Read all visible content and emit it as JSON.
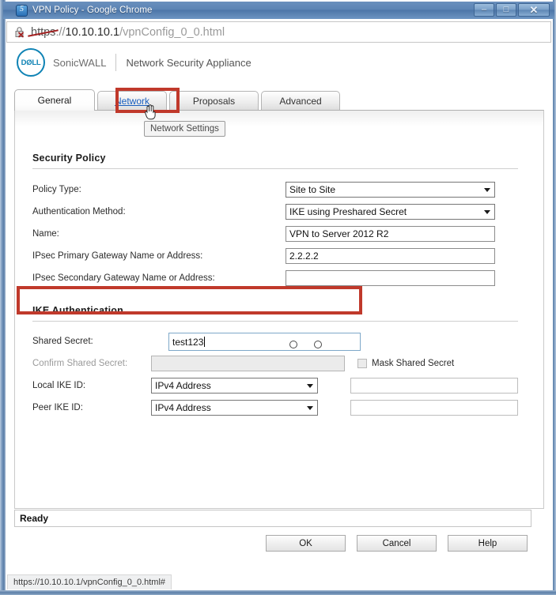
{
  "window": {
    "title": "VPN Policy - Google Chrome",
    "icon": "chrome-icon",
    "minimize_label": "–",
    "maximize_label": "□",
    "close_label": "✕"
  },
  "address_bar": {
    "security_icon": "insecure-lock-icon",
    "scheme": "https",
    "separator": "://",
    "host": "10.10.10.1",
    "path": "/vpnConfig_0_0.html",
    "full_url": "https://10.10.10.1/vpnConfig_0_0.html"
  },
  "brand": {
    "logo_text": "DØLL",
    "logo_name": "dell-logo",
    "vendor": "SonicWALL",
    "product": "Network Security Appliance"
  },
  "tabs": [
    {
      "label": "General",
      "active": true,
      "link": false
    },
    {
      "label": "Network",
      "active": false,
      "link": true
    },
    {
      "label": "Proposals",
      "active": false,
      "link": false
    },
    {
      "label": "Advanced",
      "active": false,
      "link": false
    }
  ],
  "tooltip": {
    "text": "Network Settings"
  },
  "highlight_color": "#c0392b",
  "sections": {
    "security_policy": {
      "heading": "Security Policy",
      "fields": [
        {
          "label": "Policy Type:",
          "type": "select",
          "value": "Site to Site"
        },
        {
          "label": "Authentication Method:",
          "type": "select",
          "value": "IKE using Preshared Secret"
        },
        {
          "label": "Name:",
          "type": "text",
          "value": "VPN to Server 2012 R2"
        },
        {
          "label": "IPsec Primary Gateway Name or Address:",
          "type": "text",
          "value": "2.2.2.2"
        },
        {
          "label": "IPsec Secondary Gateway Name or Address:",
          "type": "text",
          "value": ""
        }
      ]
    },
    "ike_authentication": {
      "heading": "IKE Authentication",
      "shared_secret": {
        "label": "Shared Secret:",
        "value": "test123",
        "highlighted": true
      },
      "confirm_shared_secret": {
        "label": "Confirm Shared Secret:",
        "value": "",
        "disabled": true
      },
      "mask_shared_secret": {
        "label": "Mask Shared Secret",
        "checked": false
      },
      "local_ike_id": {
        "label": "Local IKE ID:",
        "select_value": "IPv4 Address",
        "text_value": ""
      },
      "peer_ike_id": {
        "label": "Peer IKE ID:",
        "select_value": "IPv4 Address",
        "text_value": ""
      }
    }
  },
  "status": {
    "ready_text": "Ready"
  },
  "buttons": {
    "ok": "OK",
    "cancel": "Cancel",
    "help": "Help"
  },
  "status_strip": {
    "url": "https://10.10.10.1/vpnConfig_0_0.html#"
  }
}
